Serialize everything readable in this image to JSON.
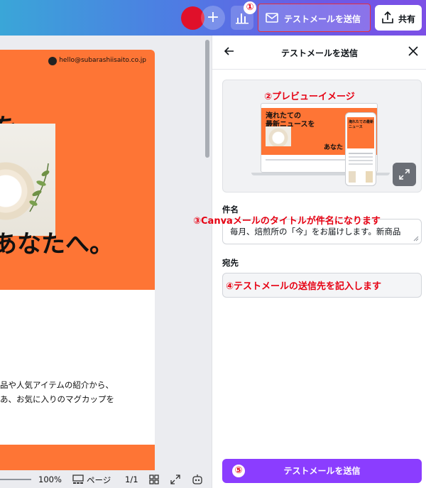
{
  "topbar": {
    "add_label": "+",
    "send_test_email_label": "テストメールを送信",
    "share_label": "共有"
  },
  "canvas": {
    "email_address": "hello@subarashiisaito.co.jp",
    "headline_top": "を",
    "headline_main": "あなたへ。",
    "body_line_1": "品や人気アイテムの紹介から、",
    "body_line_2": "あ、お気に入りのマグカップを"
  },
  "bottombar": {
    "zoom": "100%",
    "pages_label": "ページ",
    "page_count": "1/1"
  },
  "panel": {
    "title": "テストメールを送信",
    "subject_label": "件名",
    "subject_value": "毎月、焙煎所の「今」をお届けします。新商品",
    "to_label": "宛先",
    "to_value": "",
    "send_button_label": "テストメールを送信",
    "preview": {
      "laptop_headline_1": "淹れたての",
      "laptop_headline_2": "最新ニュースを",
      "laptop_headline_3": "あなた",
      "phone_headline": "淹れたての最新ニュース"
    }
  },
  "annotations": {
    "a1": "①",
    "a2": "②プレビューイメージ",
    "a3": "③Canvaメールのタイトルが件名になります",
    "a4": "④テストメールの送信先を記入します",
    "a5": "⑤"
  },
  "colors": {
    "accent_purple": "#8b3dff",
    "design_orange": "#fe7535",
    "annotation_red": "#e60012"
  }
}
